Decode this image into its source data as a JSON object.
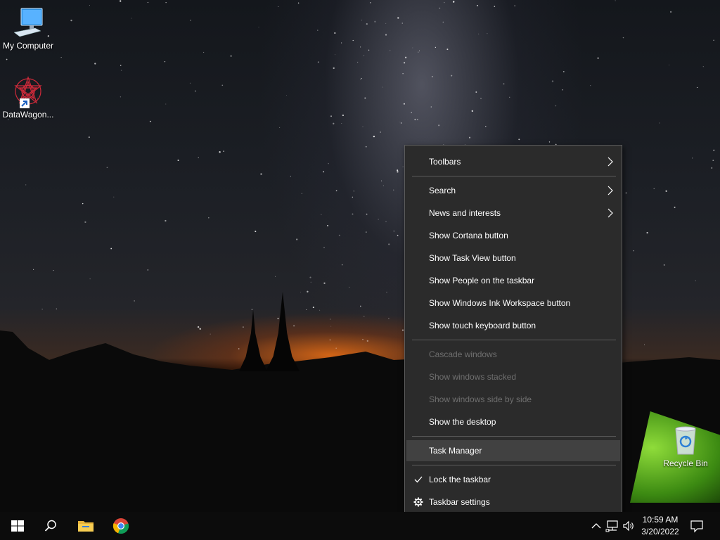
{
  "desktop": {
    "icons": [
      {
        "label": "My Computer"
      },
      {
        "label": "DataWagon..."
      },
      {
        "label": "Recycle Bin"
      }
    ]
  },
  "context_menu": {
    "items": [
      {
        "label": "Toolbars",
        "submenu": true
      },
      {
        "label": "Search",
        "submenu": true
      },
      {
        "label": "News and interests",
        "submenu": true
      },
      {
        "label": "Show Cortana button"
      },
      {
        "label": "Show Task View button"
      },
      {
        "label": "Show People on the taskbar"
      },
      {
        "label": "Show Windows Ink Workspace button"
      },
      {
        "label": "Show touch keyboard button"
      },
      {
        "label": "Cascade windows",
        "disabled": true
      },
      {
        "label": "Show windows stacked",
        "disabled": true
      },
      {
        "label": "Show windows side by side",
        "disabled": true
      },
      {
        "label": "Show the desktop"
      },
      {
        "label": "Task Manager",
        "highlighted": true
      },
      {
        "label": "Lock the taskbar",
        "checked": true
      },
      {
        "label": "Taskbar settings",
        "icon": "gear-icon"
      }
    ]
  },
  "taskbar": {
    "pinned": [
      {
        "icon": "windows-start-icon"
      },
      {
        "icon": "search-icon"
      },
      {
        "icon": "file-explorer-icon"
      },
      {
        "icon": "chrome-icon"
      }
    ],
    "tray_icons": [
      "chevron-up-icon",
      "network-icon",
      "volume-icon",
      "notification-icon"
    ],
    "clock": {
      "time": "10:59 AM",
      "date": "3/20/2022"
    }
  },
  "colors": {
    "menu_bg": "#2b2b2b",
    "menu_hover": "#414141",
    "menu_disabled_text": "#6f6f6f",
    "taskbar_bg": "#0c0c0c"
  }
}
